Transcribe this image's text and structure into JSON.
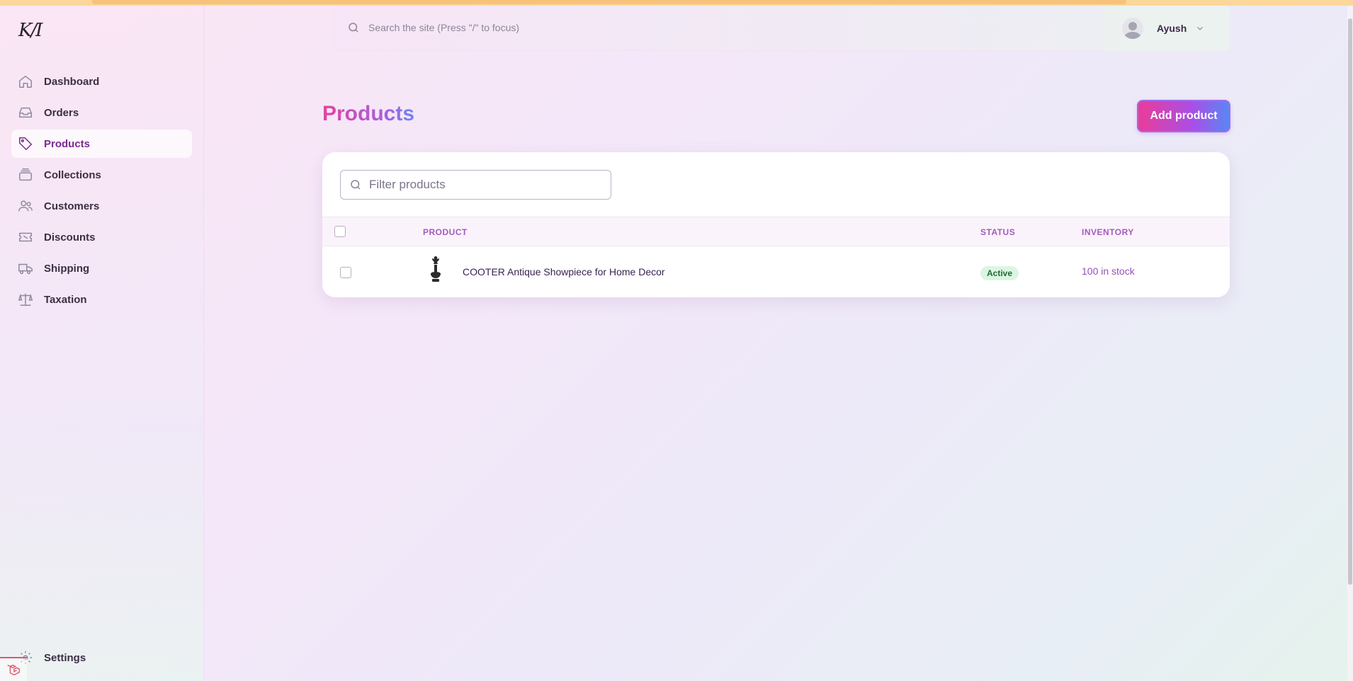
{
  "app": {
    "logo": "K/I"
  },
  "sidebar": {
    "items": [
      {
        "label": "Dashboard",
        "icon": "home-icon"
      },
      {
        "label": "Orders",
        "icon": "inbox-icon"
      },
      {
        "label": "Products",
        "icon": "tag-icon",
        "active": true
      },
      {
        "label": "Collections",
        "icon": "stack-icon"
      },
      {
        "label": "Customers",
        "icon": "users-icon"
      },
      {
        "label": "Discounts",
        "icon": "ticket-icon"
      },
      {
        "label": "Shipping",
        "icon": "truck-icon"
      },
      {
        "label": "Taxation",
        "icon": "scale-icon"
      }
    ],
    "settings_label": "Settings"
  },
  "header": {
    "search_placeholder": "Search the site (Press \"/\" to focus)",
    "user_name": "Ayush"
  },
  "main": {
    "title": "Products",
    "add_button_label": "Add product",
    "filter_placeholder": "Filter products",
    "columns": {
      "product": "PRODUCT",
      "status": "STATUS",
      "inventory": "INVENTORY"
    },
    "rows": [
      {
        "name": "COOTER Antique Showpiece for Home Decor",
        "status": "Active",
        "inventory": "100 in stock"
      }
    ]
  },
  "colors": {
    "accent": "#7b2a8f",
    "brand_gradient_start": "#ea3c97",
    "brand_gradient_end": "#5a86f5",
    "status_active_bg": "#dcf5e2",
    "status_active_text": "#1f6b35"
  }
}
